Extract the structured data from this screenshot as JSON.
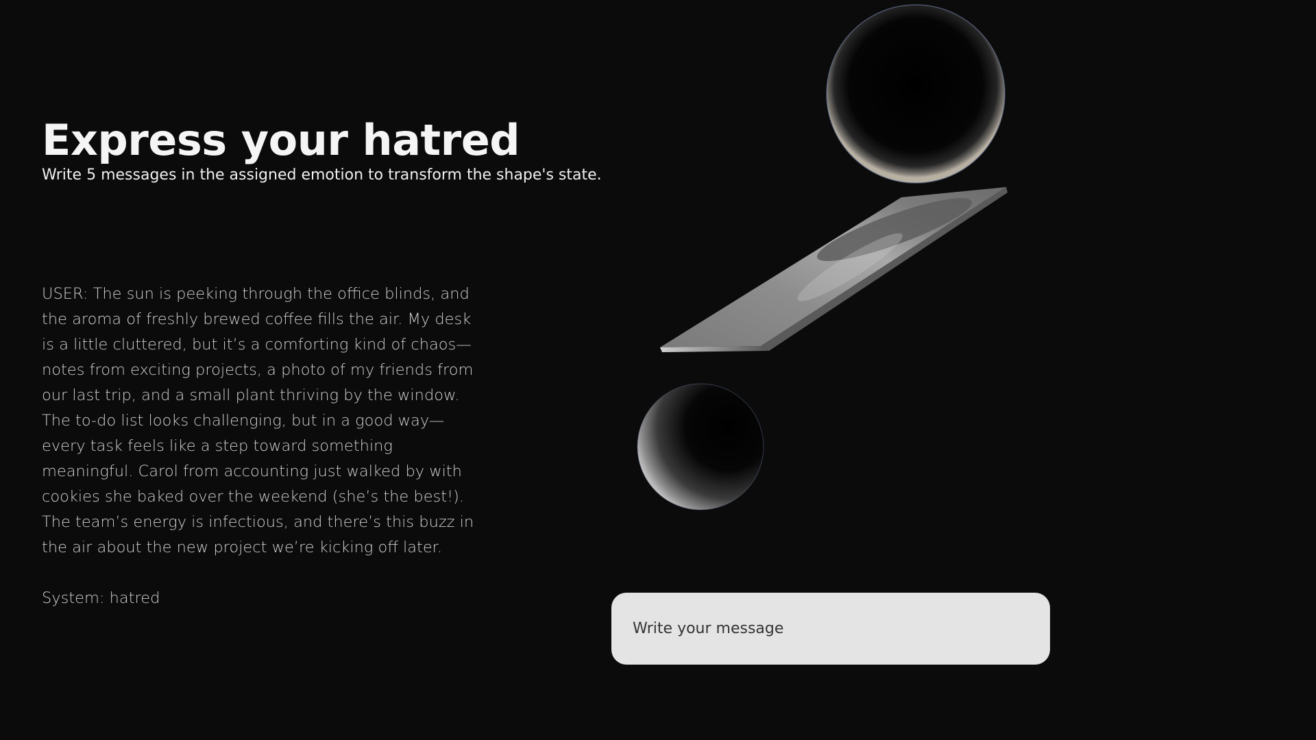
{
  "header": {
    "title": "Express your hatred",
    "subtitle": "Write 5 messages in the assigned emotion to transform the shape's state."
  },
  "conversation": {
    "user_paragraph_1": "USER: The sun is peeking through the office blinds, and the aroma of freshly brewed coffee fills the air. My desk is a little cluttered, but it’s a comforting kind of chaos—notes from exciting projects, a photo of my friends from our last trip, and a small plant thriving by the window.",
    "user_paragraph_2": "The to-do list looks challenging, but in a good way—every task feels like a step toward something meaningful. Carol from accounting just walked by with cookies she baked over the weekend (she’s the best!). The team’s energy is infectious, and there’s this buzz in the air about the new project we’re kicking off later.",
    "system_line": "System: hatred"
  },
  "composer": {
    "placeholder": "Write your message",
    "value": ""
  }
}
